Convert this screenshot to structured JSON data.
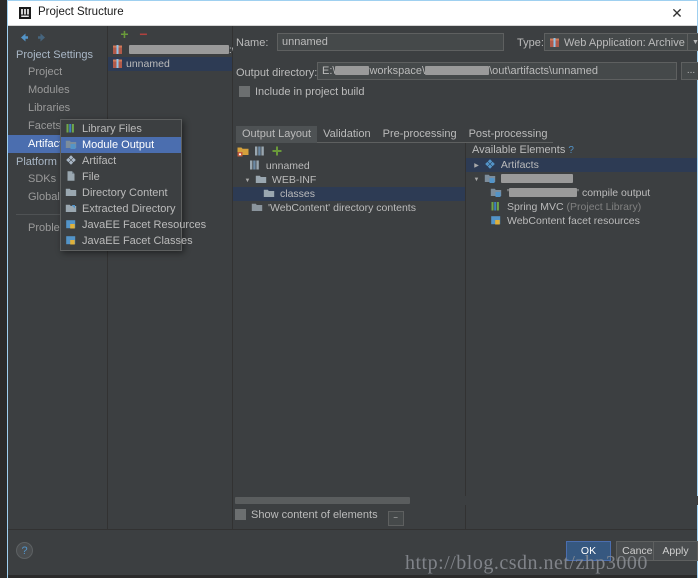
{
  "window": {
    "title": "Project Structure",
    "close_label": "✕",
    "icon": "intellij-idea-icon"
  },
  "nav": {
    "back_label": "back-arrow",
    "forward_label": "forward-arrow"
  },
  "sidebar": {
    "groups": [
      {
        "label": "Project Settings",
        "items": [
          {
            "label": "Project",
            "selected": false
          },
          {
            "label": "Modules",
            "selected": false
          },
          {
            "label": "Libraries",
            "selected": false
          },
          {
            "label": "Facets",
            "selected": false
          },
          {
            "label": "Artifacts",
            "selected": true
          }
        ]
      },
      {
        "label": "Platform Settings",
        "items": [
          {
            "label": "SDKs",
            "selected": false
          },
          {
            "label": "Global Libraries",
            "selected": false
          }
        ]
      }
    ],
    "extra": [
      {
        "label": "Problems",
        "selected": false
      }
    ]
  },
  "artifact_list": {
    "add_label": "+",
    "remove_label": "−",
    "rows": [
      {
        "label": ":war exploded",
        "redacted_prefix": true,
        "selected": false
      },
      {
        "label": "unnamed",
        "redacted_prefix": false,
        "selected": true
      }
    ]
  },
  "form": {
    "name_label": "Name:",
    "name_value": "unnamed",
    "type_label": "Type:",
    "type_value": "Web Application: Archive",
    "type_arrow": "▼",
    "output_dir_label": "Output directory:",
    "output_dir_prefix": "E:\\",
    "output_dir_mid": "workspace\\",
    "output_dir_suffix": "\\out\\artifacts\\unnamed",
    "browse_label": "...",
    "include_in_build_label": "Include in project build",
    "include_in_build_checked": false
  },
  "tabs": [
    {
      "label": "Output Layout",
      "active": true
    },
    {
      "label": "Validation",
      "active": false
    },
    {
      "label": "Pre-processing",
      "active": false
    },
    {
      "label": "Post-processing",
      "active": false
    }
  ],
  "output_layout": {
    "toolbar_icons": [
      "add-folder-icon",
      "library-files-icon",
      "add-copy-icon"
    ],
    "tree": [
      {
        "label": "unnamed",
        "indent": 0,
        "icon": "archive-icon",
        "twisty": "",
        "selected": false
      },
      {
        "label": "WEB-INF",
        "indent": 1,
        "icon": "folder-icon",
        "twisty": "▼",
        "selected": false
      },
      {
        "label": "classes",
        "indent": 2,
        "icon": "folder-icon",
        "twisty": "",
        "selected": true
      },
      {
        "label": "'WebContent' directory contents",
        "indent": 1,
        "icon": "dir-content-icon",
        "twisty": "",
        "selected": false
      }
    ]
  },
  "available_elements": {
    "header": "Available Elements",
    "help_glyph": "?",
    "tree": [
      {
        "label": "Artifacts",
        "indent": 0,
        "icon": "artifact-icon",
        "twisty": "▶",
        "selected": true,
        "redacted": false,
        "suffix": ""
      },
      {
        "label": "",
        "indent": 0,
        "icon": "module-output-icon",
        "twisty": "▼",
        "selected": false,
        "redacted": true,
        "redact_width": 72,
        "suffix": ""
      },
      {
        "label": "",
        "indent": 1,
        "icon": "module-output-icon",
        "twisty": "",
        "selected": false,
        "redacted": true,
        "redact_width": 68,
        "suffix": "' compile output",
        "prefix": "'"
      },
      {
        "label": "Spring MVC",
        "indent": 1,
        "icon": "library-files-icon",
        "twisty": "",
        "selected": false,
        "redacted": false,
        "suffix": " (Project Library)"
      },
      {
        "label": "WebContent facet resources",
        "indent": 1,
        "icon": "facet-resources-icon",
        "twisty": "",
        "selected": false,
        "redacted": false,
        "suffix": ""
      }
    ]
  },
  "context_menu": {
    "items": [
      {
        "label": "Library Files",
        "icon": "library-files-icon",
        "highlighted": false
      },
      {
        "label": "Module Output",
        "icon": "module-output-icon",
        "highlighted": true
      },
      {
        "label": "Artifact",
        "icon": "artifact-icon",
        "highlighted": false
      },
      {
        "label": "File",
        "icon": "file-icon",
        "highlighted": false
      },
      {
        "label": "Directory Content",
        "icon": "folder-icon",
        "highlighted": false
      },
      {
        "label": "Extracted Directory",
        "icon": "extracted-dir-icon",
        "highlighted": false
      },
      {
        "label": "JavaEE Facet Resources",
        "icon": "javaee-facet-icon",
        "highlighted": false
      },
      {
        "label": "JavaEE Facet Classes",
        "icon": "javaee-facet-icon",
        "highlighted": false
      }
    ]
  },
  "bottom": {
    "show_content_label": "Show content of elements",
    "show_content_checked": false,
    "expand_label": "−"
  },
  "footer": {
    "help_label": "?",
    "buttons": [
      {
        "label": "OK",
        "default": true
      },
      {
        "label": "Cancel",
        "default": false
      },
      {
        "label": "Apply",
        "default": false
      }
    ]
  },
  "watermark": {
    "text": "http://blog.csdn.net/zhp3000"
  },
  "colors": {
    "dialog_bg": "#3c3f41",
    "selection_blue": "#4b6eaf",
    "tree_selection": "#2d3b54",
    "titlebar_bg": "#ffffff",
    "text": "#bbbbbb",
    "accent_link": "#5394c8"
  }
}
